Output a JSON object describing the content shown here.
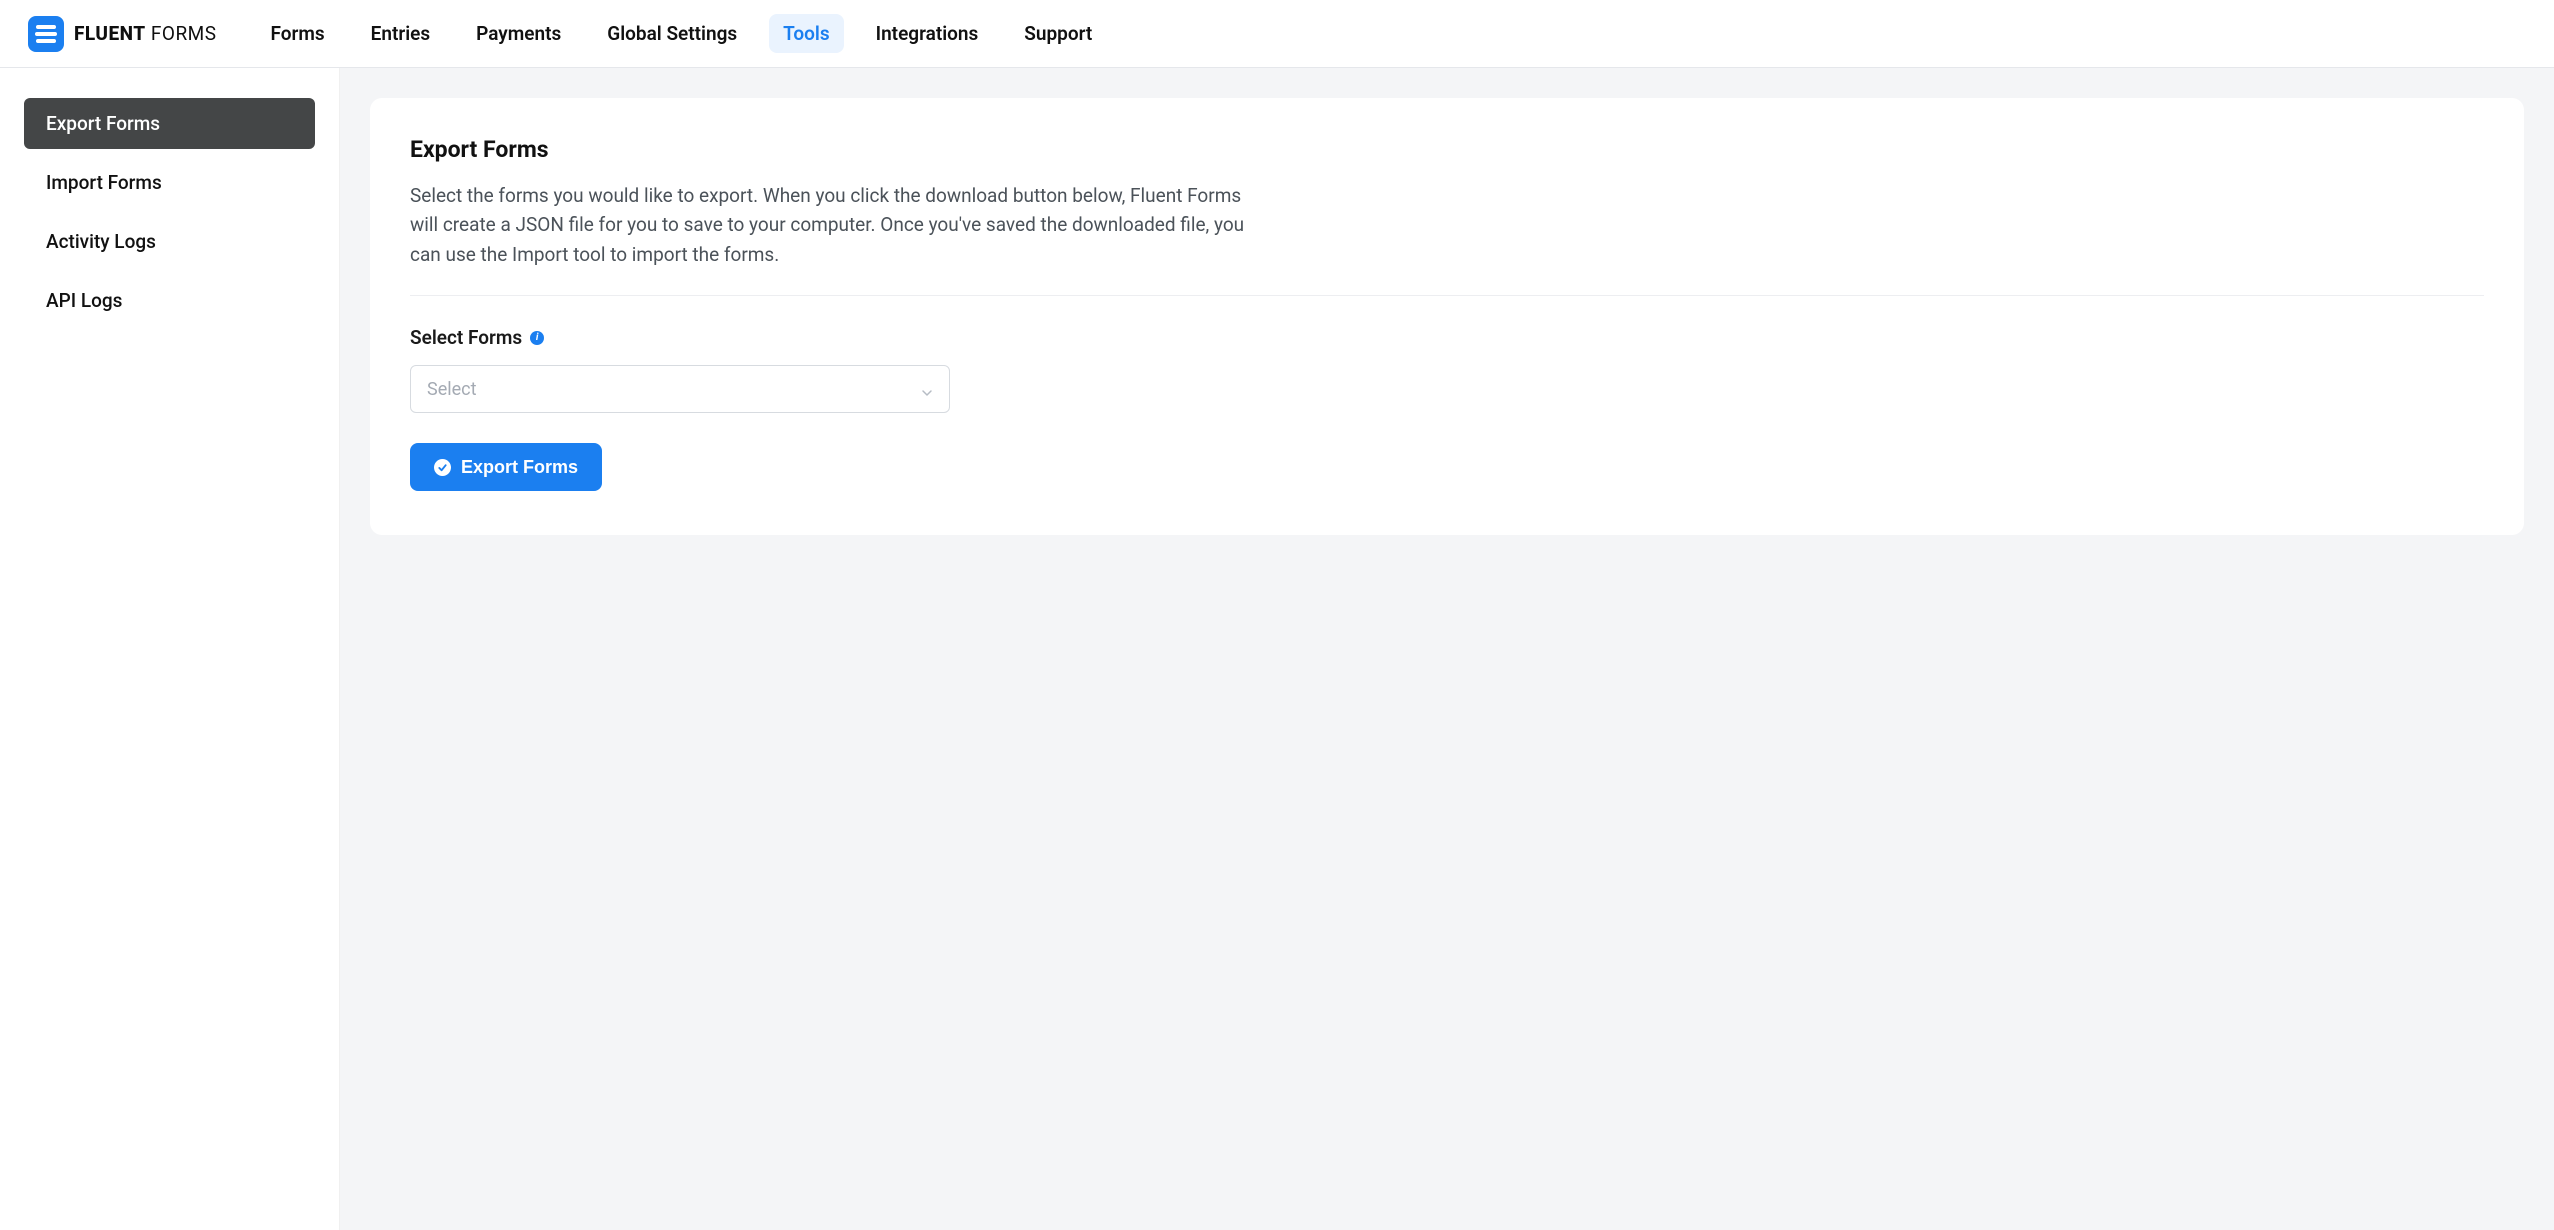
{
  "brand": {
    "bold": "FLUENT",
    "thin": " FORMS"
  },
  "nav": {
    "items": [
      {
        "label": "Forms",
        "active": false
      },
      {
        "label": "Entries",
        "active": false
      },
      {
        "label": "Payments",
        "active": false
      },
      {
        "label": "Global Settings",
        "active": false
      },
      {
        "label": "Tools",
        "active": true
      },
      {
        "label": "Integrations",
        "active": false
      },
      {
        "label": "Support",
        "active": false
      }
    ]
  },
  "sidebar": {
    "items": [
      {
        "label": "Export Forms",
        "active": true
      },
      {
        "label": "Import Forms",
        "active": false
      },
      {
        "label": "Activity Logs",
        "active": false
      },
      {
        "label": "API Logs",
        "active": false
      }
    ]
  },
  "card": {
    "title": "Export Forms",
    "description": "Select the forms you would like to export. When you click the download button below, Fluent Forms will create a JSON file for you to save to your computer. Once you've saved the downloaded file, you can use the Import tool to import the forms.",
    "field_label": "Select Forms",
    "select_placeholder": "Select",
    "button_label": "Export Forms"
  }
}
